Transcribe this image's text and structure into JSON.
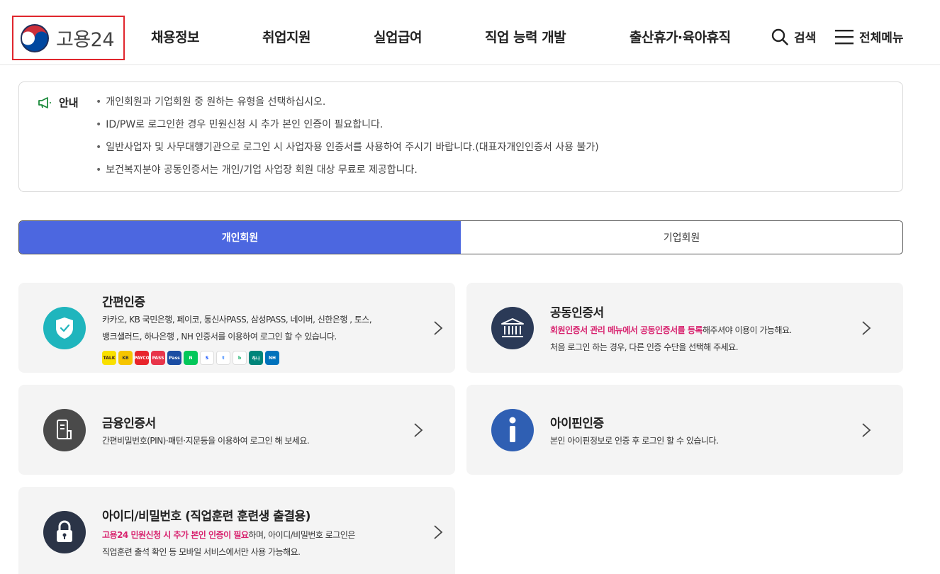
{
  "header": {
    "utility_text": "· · · · · · · · · · · · · ·",
    "logo_text": "고용24",
    "nav": [
      "채용정보",
      "취업지원",
      "실업급여",
      "직업 능력 개발",
      "출산휴가·육아휴직"
    ],
    "search_label": "검색",
    "allmenu_label": "전체메뉴"
  },
  "notice": {
    "title": "안내",
    "items": [
      "개인회원과 기업회원 중 원하는 유형을 선택하십시오.",
      "ID/PW로 로그인한 경우 민원신청 시 추가 본인 인증이 필요합니다.",
      "일반사업자 및 사무대행기관으로 로그인 시 사업자용 인증서를 사용하여 주시기 바랍니다.(대표자개인인증서 사용 불가)",
      "보건복지분야 공동인증서는 개인/기업 사업장 회원 대상 무료로 제공합니다."
    ]
  },
  "tabs": {
    "personal": "개인회원",
    "business": "기업회원",
    "active": "personal"
  },
  "cards": {
    "simple": {
      "title": "간편인증",
      "desc1": "카카오, KB 국민은행, 페이코, 통신사PASS, 삼성PASS, 네이버, 신한은행 , 토스,",
      "desc2": "뱅크샐러드, 하나은행 , NH 인증서를 이용하여 로그인 할 수 있습니다."
    },
    "joint": {
      "title": "공동인증서",
      "desc1_hl": "회원인증서 관리 메뉴에서 공동인증서를 등록",
      "desc1_rest": "해주셔야 이용이 가능해요.",
      "desc2": "처음 로그인 하는 경우, 다른 인증 수단을 선택해 주세요."
    },
    "financial": {
      "title": "금융인증서",
      "desc1": "간편비밀번호(PIN)·패턴·지문등을 이용하여 로그인 해 보세요."
    },
    "ipin": {
      "title": "아이핀인증",
      "desc1": "본인 아이핀정보로 인증 후 로그인 할 수 있습니다."
    },
    "idpw": {
      "title": "아이디/비밀번호 (직업훈련 훈련생 출결용)",
      "desc1_hl": "고용24 민원신청 시 추가 본인 인증이 필요",
      "desc1_rest": "하며, 아이디/비밀번호 로그인은",
      "desc2": "직업훈련 출석 확인 등 모바일 서비스에서만 사용 가능해요."
    }
  },
  "badges": [
    {
      "name": "kakao-badge",
      "text": "TALK",
      "color": "#f9e000",
      "fg": "#3a1d1d"
    },
    {
      "name": "kb-badge",
      "text": "KB",
      "color": "#f6c500",
      "fg": "#333"
    },
    {
      "name": "payco-badge",
      "text": "PAYCO",
      "color": "#e8252b",
      "fg": "#fff"
    },
    {
      "name": "pass-badge",
      "text": "PASS",
      "color": "#e8354a",
      "fg": "#fff"
    },
    {
      "name": "samsung-pass-badge",
      "text": "Pass",
      "color": "#1b4da3",
      "fg": "#fff"
    },
    {
      "name": "naver-badge",
      "text": "N",
      "color": "#03c75a",
      "fg": "#fff"
    },
    {
      "name": "shinhan-badge",
      "text": "S",
      "color": "#ffffff",
      "fg": "#0046ff"
    },
    {
      "name": "toss-badge",
      "text": "t",
      "color": "#ffffff",
      "fg": "#0064ff"
    },
    {
      "name": "banksalad-badge",
      "text": "b",
      "color": "#ffffff",
      "fg": "#19b26b"
    },
    {
      "name": "hana-badge",
      "text": "하나",
      "color": "#00857a",
      "fg": "#fff"
    },
    {
      "name": "nh-badge",
      "text": "NH",
      "color": "#0072bc",
      "fg": "#fff"
    }
  ],
  "colors": {
    "accent": "#4c67e0",
    "highlight": "#d8226e",
    "logo_border": "#e0262d",
    "card_bg": "#f4f4f4"
  }
}
